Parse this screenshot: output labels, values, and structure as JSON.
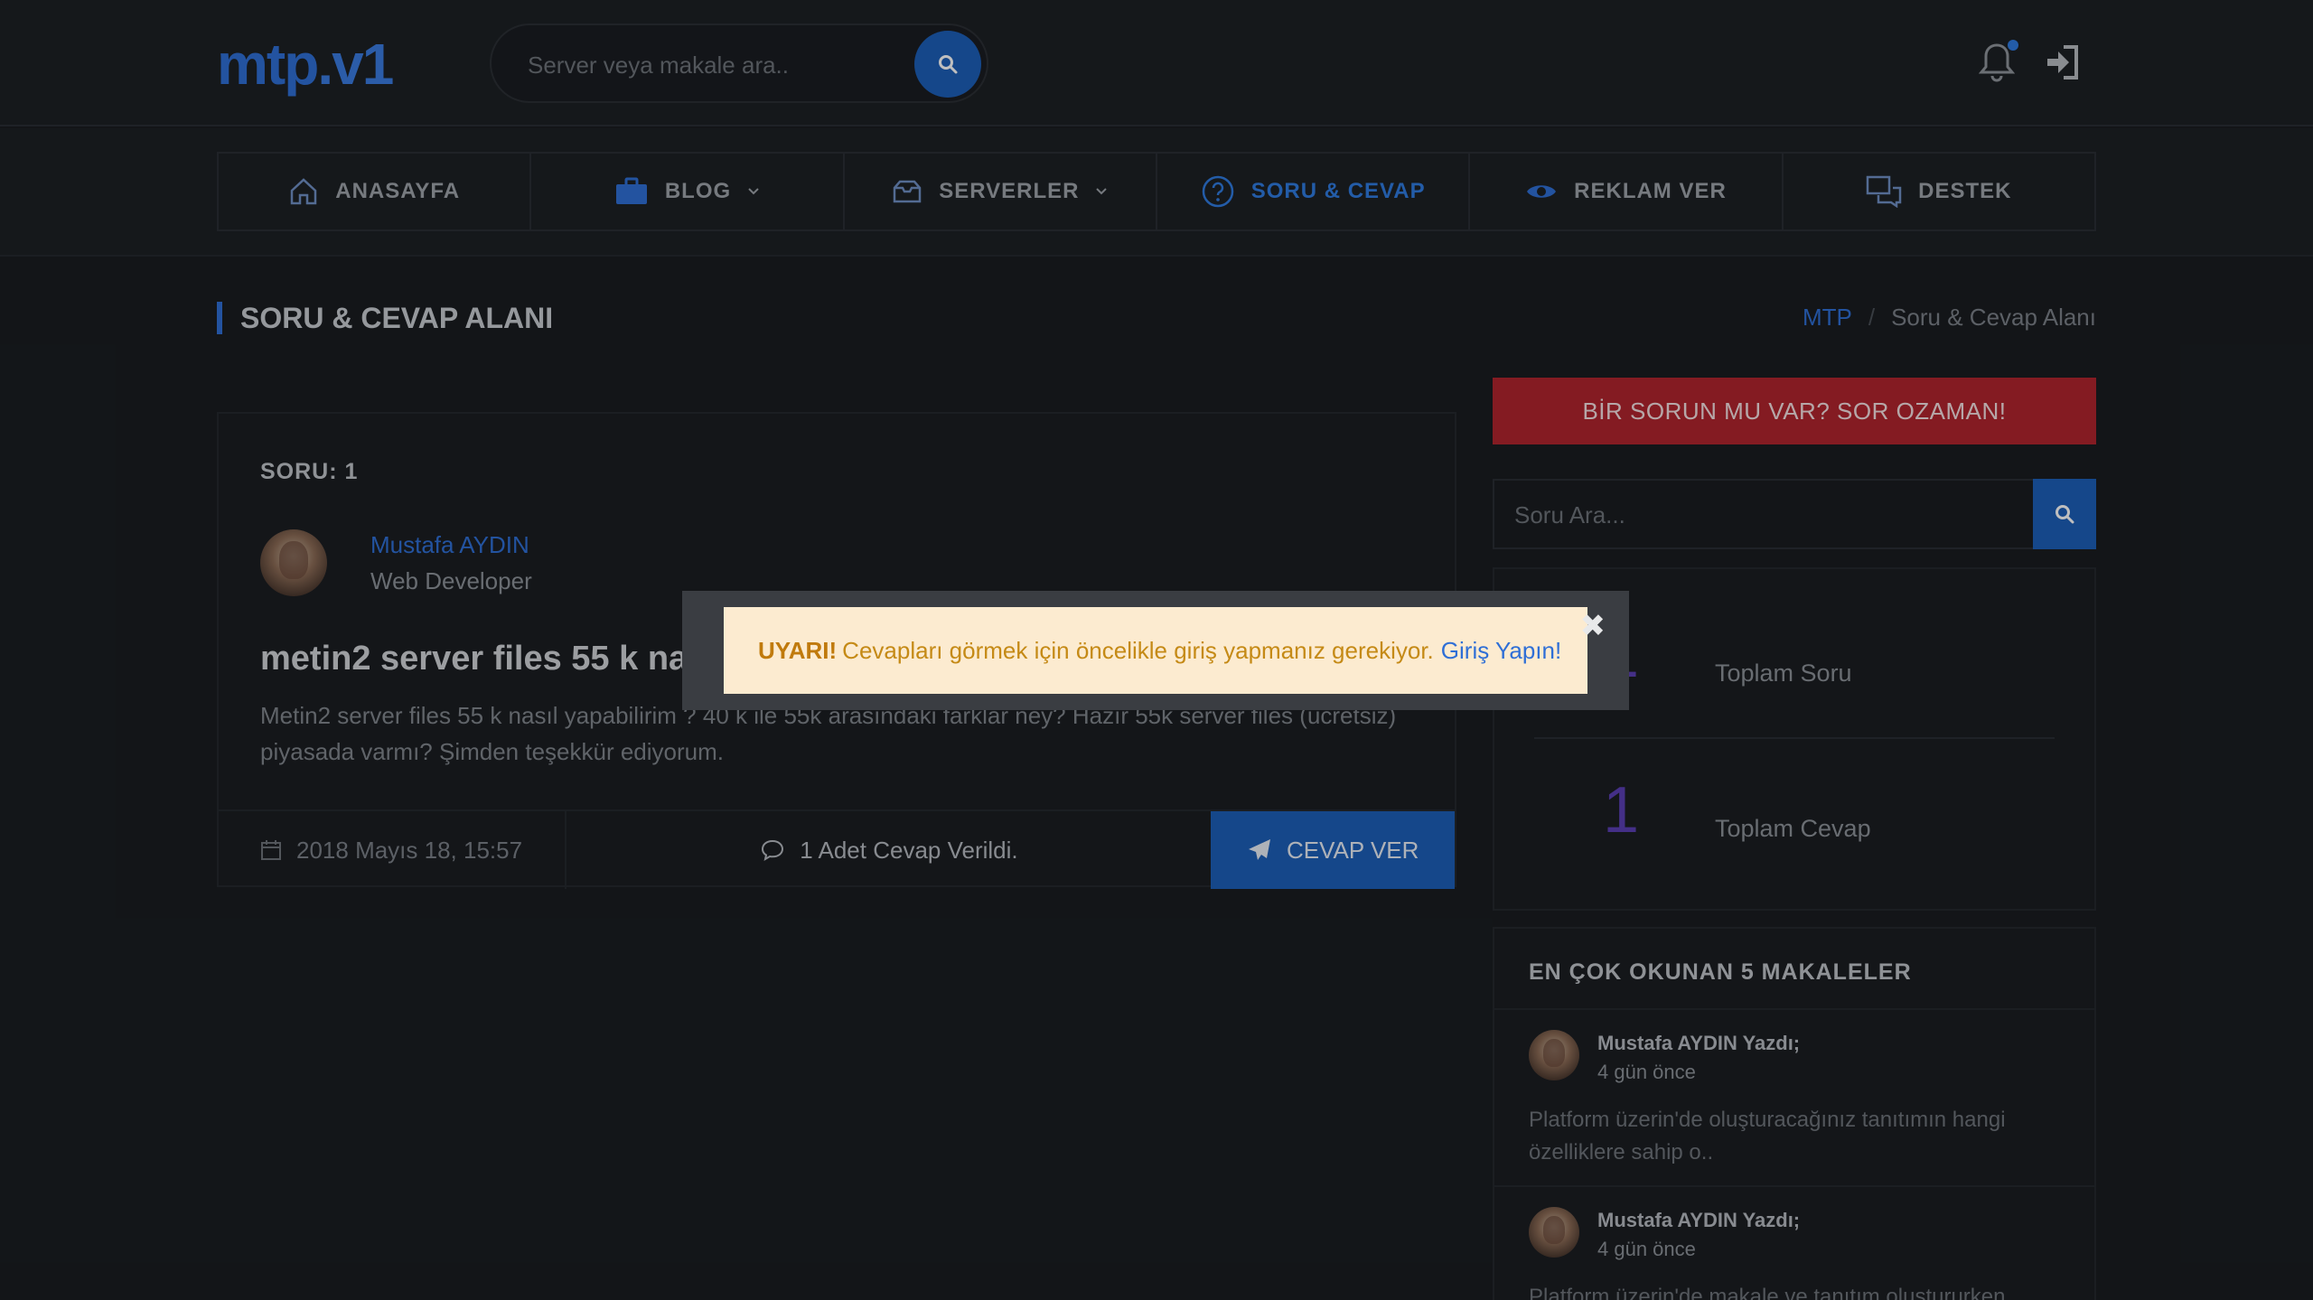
{
  "header": {
    "logo_main": "mtp",
    "logo_suffix": ".v1",
    "search_placeholder": "Server veya makale ara.."
  },
  "nav": {
    "items": [
      {
        "label": "ANASAYFA",
        "icon": "home-icon"
      },
      {
        "label": "BLOG",
        "icon": "briefcase-icon",
        "dropdown": true
      },
      {
        "label": "SERVERLER",
        "icon": "inbox-icon",
        "dropdown": true
      },
      {
        "label": "SORU & CEVAP",
        "icon": "question-circle-icon",
        "active": true
      },
      {
        "label": "REKLAM VER",
        "icon": "eye-icon"
      },
      {
        "label": "DESTEK",
        "icon": "chat-icon"
      }
    ]
  },
  "page": {
    "title": "SORU & CEVAP ALANI",
    "breadcrumb": {
      "home": "MTP",
      "sep": "/",
      "current": "Soru & Cevap Alanı"
    }
  },
  "question": {
    "label": "SORU: 1",
    "author": "Mustafa AYDIN",
    "role": "Web Developer",
    "title": "metin2 server files 55 k na",
    "text": "Metin2 server files 55 k nasıl yapabilirim ? 40 k ile 55k arasındaki farklar ney? Hazır 55k server files (ücretsiz) piyasada varmı? Şimden teşekkür ediyorum.",
    "date": "2018 Mayıs 18, 15:57",
    "answers": "1 Adet Cevap Verildi.",
    "reply_label": "CEVAP VER"
  },
  "sidebar": {
    "ask_label": "BİR SORUN MU VAR? SOR OZAMAN!",
    "search_placeholder": "Soru Ara...",
    "stats": [
      {
        "value": "1",
        "label": "Toplam Soru"
      },
      {
        "value": "1",
        "label": "Toplam Cevap"
      }
    ],
    "popular_title": "EN ÇOK OKUNAN 5 MAKALELER",
    "posts": [
      {
        "author": "Mustafa AYDIN Yazdı;",
        "time": "4 gün önce",
        "text": "Platform üzerin'de oluşturacağınız tanıtımın hangi özelliklere sahip o.."
      },
      {
        "author": "Mustafa AYDIN Yazdı;",
        "time": "4 gün önce",
        "text": "Platform üzerin'de makale ve tanıtım oluştururken"
      }
    ]
  },
  "modal": {
    "warning": "UYARI!",
    "message": "Cevapları görmek için öncelikle giriş yapmanız gerekiyor.",
    "link": "Giriş Yapın!",
    "close": "✖"
  },
  "colors": {
    "accent": "#1d5fb8",
    "danger": "#b0242e",
    "stat": "#5b3fb5",
    "alert_bg": "#fcebd0"
  }
}
